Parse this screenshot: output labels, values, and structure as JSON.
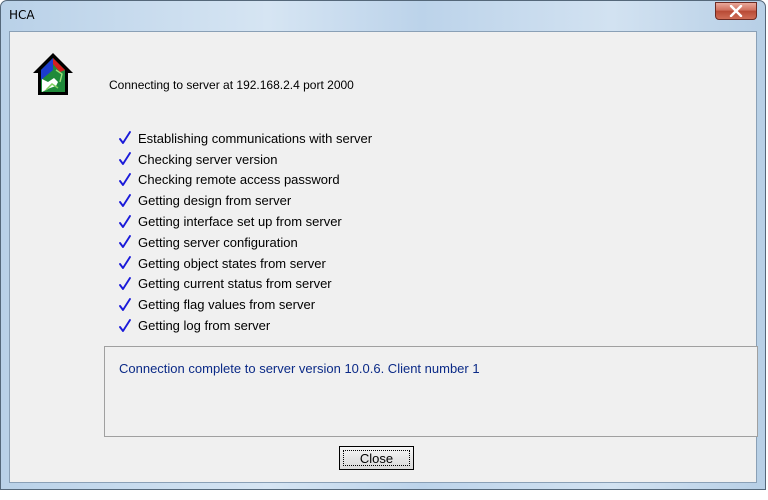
{
  "window": {
    "title": "HCA"
  },
  "icons": {
    "app": "hca-house-icon",
    "close": "close-icon",
    "check": "checkmark-icon"
  },
  "header": {
    "connect_text": "Connecting to server at 192.168.2.4 port 2000"
  },
  "steps": [
    "Establishing communications with server",
    "Checking server version",
    "Checking remote access password",
    "Getting design from server",
    "Getting interface set up from server",
    "Getting server configuration",
    "Getting object states from server",
    "Getting current status from server",
    "Getting flag values from server",
    "Getting log from server"
  ],
  "status": {
    "message": "Connection complete to server version 10.0.6.  Client number 1"
  },
  "buttons": {
    "close_label": "Close"
  },
  "colors": {
    "check": "#1a1ad9",
    "status_text": "#0b2a87"
  }
}
